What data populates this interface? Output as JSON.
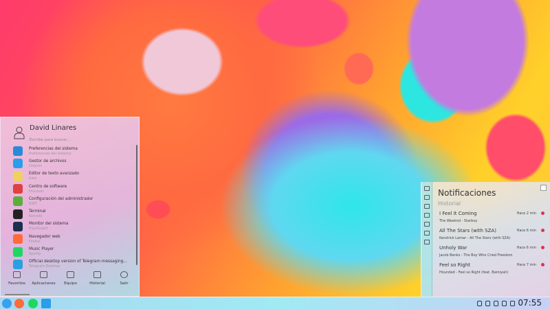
{
  "menu": {
    "user": "David Linares",
    "search_placeholder": "Escribe para buscar...",
    "apps": [
      {
        "title": "Preferencias del sistema",
        "sub": "Preferencias del sistema",
        "color": "#2a8ad8"
      },
      {
        "title": "Gestor de archivos",
        "sub": "Dolphin",
        "color": "#2a9ee8"
      },
      {
        "title": "Editor de texto avanzado",
        "sub": "Kate",
        "color": "#f0d060"
      },
      {
        "title": "Centro de software",
        "sub": "Discover",
        "color": "#e04040"
      },
      {
        "title": "Configuración del administrador",
        "sub": "KiiET",
        "color": "#5cae3c"
      },
      {
        "title": "Terminal",
        "sub": "Konsole",
        "color": "#222222"
      },
      {
        "title": "Monitor del sistema",
        "sub": "KSysGuard",
        "color": "#1a3050"
      },
      {
        "title": "Navegador web",
        "sub": "Firefox",
        "color": "#ff6a3a"
      },
      {
        "title": "Music Player",
        "sub": "Spotify",
        "color": "#1ed760"
      },
      {
        "title": "Official desktop version of Telegram messaging...",
        "sub": "Telegram Desktop",
        "color": "#2aa0e0"
      }
    ],
    "tabs": [
      "Favoritos",
      "Aplicaciones",
      "Equipo",
      "Historial",
      "Salir"
    ]
  },
  "notifications": {
    "title": "Notificaciones",
    "section": "Historial",
    "items": [
      {
        "title": "I Feel It Coming",
        "sub": "The Weeknd - Starboy",
        "time": "Hace 2 min"
      },
      {
        "title": "All The Stars (with SZA)",
        "sub": "Kendrick Lamar - All The Stars (with SZA)",
        "time": "Hace 6 min"
      },
      {
        "title": "Unholy War",
        "sub": "Jacob Banks - The Boy Who Cried Freedom",
        "time": "Hace 6 min"
      },
      {
        "title": "Feel so Right",
        "sub": "Hounded - Feel so Right (feat. Bamiyah)",
        "time": "Hace 7 min"
      }
    ]
  },
  "taskbar": {
    "clock": "07:55"
  }
}
